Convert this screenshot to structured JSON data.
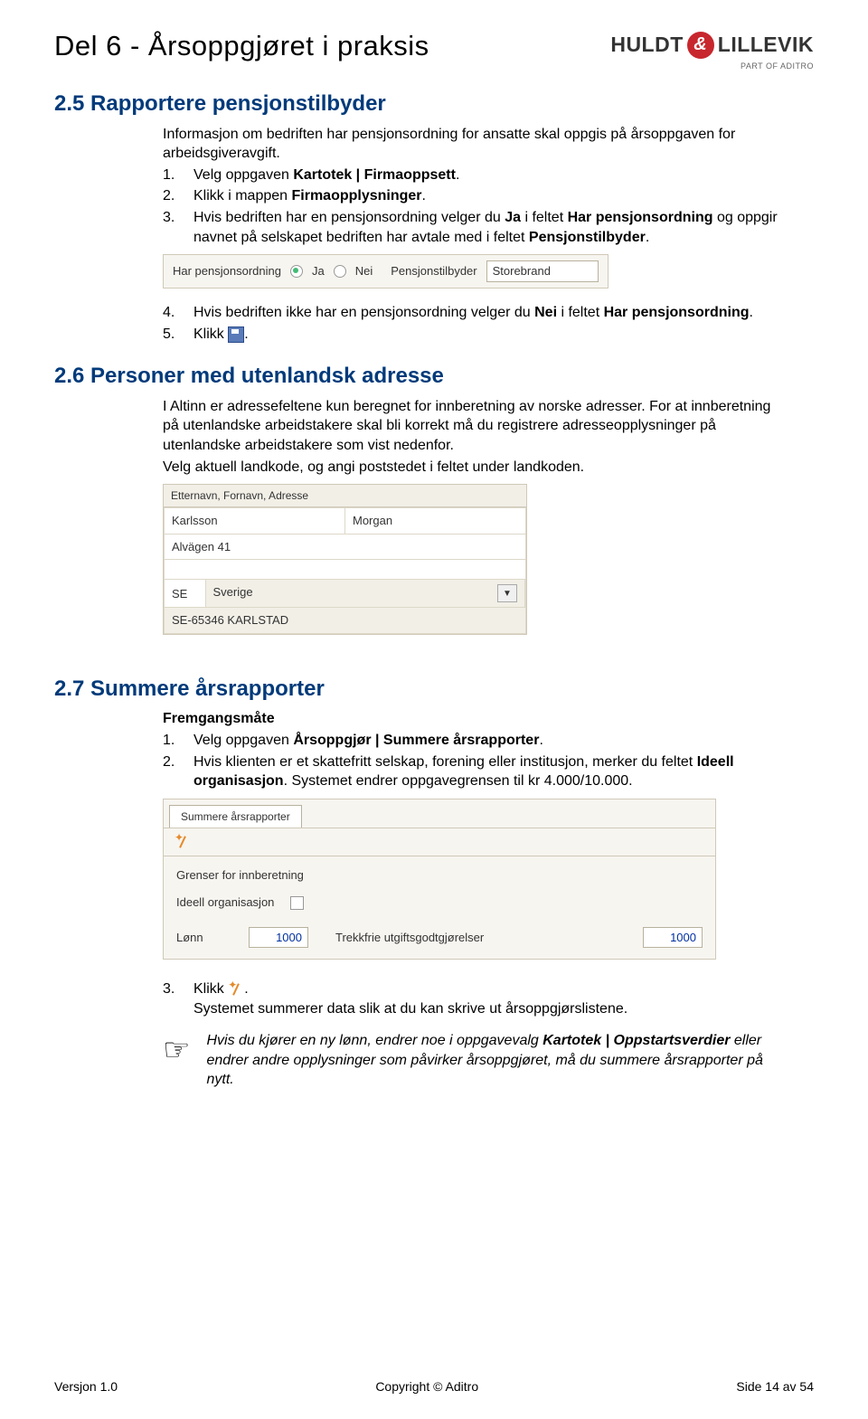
{
  "header": {
    "title": "Del 6 - Årsoppgjøret i praksis",
    "logo_left": "HULDT",
    "logo_amp": "&",
    "logo_right": "LILLEVIK",
    "logo_sub": "PART OF ADITRO"
  },
  "s25": {
    "heading": "2.5 Rapportere pensjonstilbyder",
    "intro": "Informasjon om bedriften har pensjonsordning for ansatte skal oppgis på årsoppgaven for arbeidsgiveravgift.",
    "li1_num": "1.",
    "li1a": "Velg oppgaven ",
    "li1b": "Kartotek | Firmaoppsett",
    "li1c": ".",
    "li2_num": "2.",
    "li2a": "Klikk i mappen ",
    "li2b": "Firmaopplysninger",
    "li2c": ".",
    "li3_num": "3.",
    "li3a": "Hvis bedriften har en pensjonsordning velger du ",
    "li3b": "Ja",
    "li3c": " i feltet ",
    "li3d": "Har pensjonsordning",
    "li3e": " og oppgir navnet på selskapet bedriften har avtale med i feltet ",
    "li3f": "Pensjonstilbyder",
    "li3g": ".",
    "fig1": {
      "label1": "Har pensjonsordning",
      "ja": "Ja",
      "nei": "Nei",
      "label2": "Pensjonstilbyder",
      "value": "Storebrand"
    },
    "li4_num": "4.",
    "li4a": "Hvis bedriften ikke har en pensjonsordning velger du ",
    "li4b": "Nei",
    "li4c": " i feltet ",
    "li4d": "Har pensjonsordning",
    "li4e": ".",
    "li5_num": "5.",
    "li5": "Klikk ",
    "li5b": "."
  },
  "s26": {
    "heading": "2.6 Personer med utenlandsk adresse",
    "p1": "I Altinn er adressefeltene kun beregnet for innberetning av norske adresser. For at innberetning på utenlandske arbeidstakere skal bli korrekt må du registrere adresseopplysninger på utenlandske arbeidstakere som vist nedenfor.",
    "p2": "Velg aktuell landkode, og angi poststedet i feltet under landkoden.",
    "fig2": {
      "title": "Etternavn, Fornavn, Adresse",
      "c1": "Karlsson",
      "c2": "Morgan",
      "c3": "Alvägen 41",
      "c4": "SE",
      "c5": "Sverige",
      "c6": "SE-65346 KARLSTAD"
    }
  },
  "s27": {
    "heading": "2.7 Summere årsrapporter",
    "sub": "Fremgangsmåte",
    "li1_num": "1.",
    "li1a": "Velg oppgaven ",
    "li1b": "Årsoppgjør | Summere årsrapporter",
    "li1c": ".",
    "li2_num": "2.",
    "li2a": "Hvis klienten er et skattefritt selskap, forening eller institusjon, merker du feltet ",
    "li2b": "Ideell organisasjon",
    "li2c": ". Systemet endrer oppgavegrensen til kr 4.000/10.000.",
    "fig3": {
      "tab": "Summere årsrapporter",
      "g": "Grenser for innberetning",
      "ideell": "Ideell organisasjon",
      "lonn_lbl": "Lønn",
      "lonn_val": "1000",
      "trekk_lbl": "Trekkfrie utgiftsgodtgjørelser",
      "trekk_val": "1000"
    },
    "li3_num": "3.",
    "li3a": "Klikk ",
    "li3b": ".",
    "li3c": "Systemet summerer data slik at du kan skrive ut årsoppgjørslistene.",
    "note_hand": "☞",
    "note_a": "Hvis du kjører en ny lønn, endrer noe i oppgavevalg ",
    "note_b": "Kartotek | Oppstartsverdier",
    "note_c": " eller endrer andre opplysninger som påvirker årsoppgjøret, må du summere årsrapporter på nytt."
  },
  "footer": {
    "left": "Versjon 1.0",
    "mid": "Copyright © Aditro",
    "right": "Side 14 av 54"
  }
}
